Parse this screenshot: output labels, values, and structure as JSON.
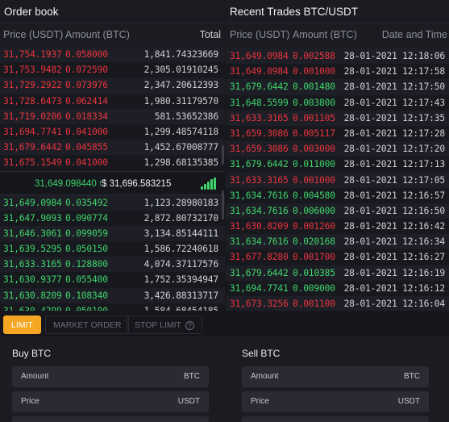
{
  "orderbook": {
    "title": "Order book",
    "headers": {
      "price": "Price (USDT)",
      "amount": "Amount (BTC)",
      "total": "Total"
    },
    "asks": [
      {
        "price": "31,754.1937",
        "amount": "0.058000",
        "total": "1,841.74323669"
      },
      {
        "price": "31,753.9482",
        "amount": "0.072590",
        "total": "2,305.01910245"
      },
      {
        "price": "31,729.2922",
        "amount": "0.073976",
        "total": "2,347.20612393"
      },
      {
        "price": "31,728.6473",
        "amount": "0.062414",
        "total": "1,980.31179570"
      },
      {
        "price": "31,719.0206",
        "amount": "0.018334",
        "total": "581.53652386"
      },
      {
        "price": "31,694.7741",
        "amount": "0.041000",
        "total": "1,299.48574118"
      },
      {
        "price": "31,679.6442",
        "amount": "0.045855",
        "total": "1,452.67008777"
      },
      {
        "price": "31,675.1549",
        "amount": "0.041000",
        "total": "1,298.68135385"
      }
    ],
    "mid": {
      "last_price": "31,649.098440",
      "arrow": "↑",
      "usd_price": "$ 31,696.583215"
    },
    "bids": [
      {
        "price": "31,649.0984",
        "amount": "0.035492",
        "total": "1,123.28980183"
      },
      {
        "price": "31,647.9093",
        "amount": "0.090774",
        "total": "2,872.80732170"
      },
      {
        "price": "31,646.3061",
        "amount": "0.099059",
        "total": "3,134.85144111"
      },
      {
        "price": "31,639.5295",
        "amount": "0.050150",
        "total": "1,586.72240618"
      },
      {
        "price": "31,633.3165",
        "amount": "0.128800",
        "total": "4,074.37117576"
      },
      {
        "price": "31,630.9377",
        "amount": "0.055400",
        "total": "1,752.35394947"
      },
      {
        "price": "31,630.8209",
        "amount": "0.108340",
        "total": "3,426.88313717"
      },
      {
        "price": "31,630.4299",
        "amount": "0.050100",
        "total": "1,584.68454185"
      }
    ]
  },
  "trades": {
    "title": "Recent Trades BTC/USDT",
    "headers": {
      "price": "Price (USDT)",
      "amount": "Amount (BTC)",
      "time": "Date and Time"
    },
    "rows": [
      {
        "price": "31,649.0984",
        "amount": "0.002588",
        "time": "28-01-2021 12:18:06",
        "side": "sell"
      },
      {
        "price": "31,649.0984",
        "amount": "0.001000",
        "time": "28-01-2021 12:17:58",
        "side": "sell"
      },
      {
        "price": "31,679.6442",
        "amount": "0.001480",
        "time": "28-01-2021 12:17:50",
        "side": "buy"
      },
      {
        "price": "31,648.5599",
        "amount": "0.003800",
        "time": "28-01-2021 12:17:43",
        "side": "buy"
      },
      {
        "price": "31,633.3165",
        "amount": "0.001105",
        "time": "28-01-2021 12:17:35",
        "side": "sell"
      },
      {
        "price": "31,659.3086",
        "amount": "0.005117",
        "time": "28-01-2021 12:17:28",
        "side": "sell"
      },
      {
        "price": "31,659.3086",
        "amount": "0.003000",
        "time": "28-01-2021 12:17:20",
        "side": "sell"
      },
      {
        "price": "31,679.6442",
        "amount": "0.011000",
        "time": "28-01-2021 12:17:13",
        "side": "buy"
      },
      {
        "price": "31,633.3165",
        "amount": "0.001000",
        "time": "28-01-2021 12:17:05",
        "side": "sell"
      },
      {
        "price": "31,634.7616",
        "amount": "0.004580",
        "time": "28-01-2021 12:16:57",
        "side": "buy"
      },
      {
        "price": "31,634.7616",
        "amount": "0.006000",
        "time": "28-01-2021 12:16:50",
        "side": "buy"
      },
      {
        "price": "31,630.8209",
        "amount": "0.001260",
        "time": "28-01-2021 12:16:42",
        "side": "sell"
      },
      {
        "price": "31,634.7616",
        "amount": "0.020168",
        "time": "28-01-2021 12:16:34",
        "side": "buy"
      },
      {
        "price": "31,677.8280",
        "amount": "0.001700",
        "time": "28-01-2021 12:16:27",
        "side": "sell"
      },
      {
        "price": "31,679.6442",
        "amount": "0.010385",
        "time": "28-01-2021 12:16:19",
        "side": "buy"
      },
      {
        "price": "31,694.7741",
        "amount": "0.009000",
        "time": "28-01-2021 12:16:12",
        "side": "buy"
      },
      {
        "price": "31,673.3256",
        "amount": "0.001100",
        "time": "28-01-2021 12:16:04",
        "side": "sell"
      }
    ]
  },
  "tabs": [
    {
      "label": "LIMIT",
      "active": true
    },
    {
      "label": "MARKET ORDER",
      "active": false
    },
    {
      "label": "STOP LIMIT",
      "active": false,
      "icon": "info-icon"
    }
  ],
  "buy": {
    "title": "Buy BTC",
    "amount_label": "Amount",
    "amount_unit": "BTC",
    "price_label": "Price",
    "price_unit": "USDT"
  },
  "sell": {
    "title": "Sell BTC",
    "amount_label": "Amount",
    "amount_unit": "BTC",
    "price_label": "Price",
    "price_unit": "USDT"
  },
  "colors": {
    "sell": "#e8343e",
    "buy": "#3fd46b",
    "accent": "#f5a623"
  }
}
